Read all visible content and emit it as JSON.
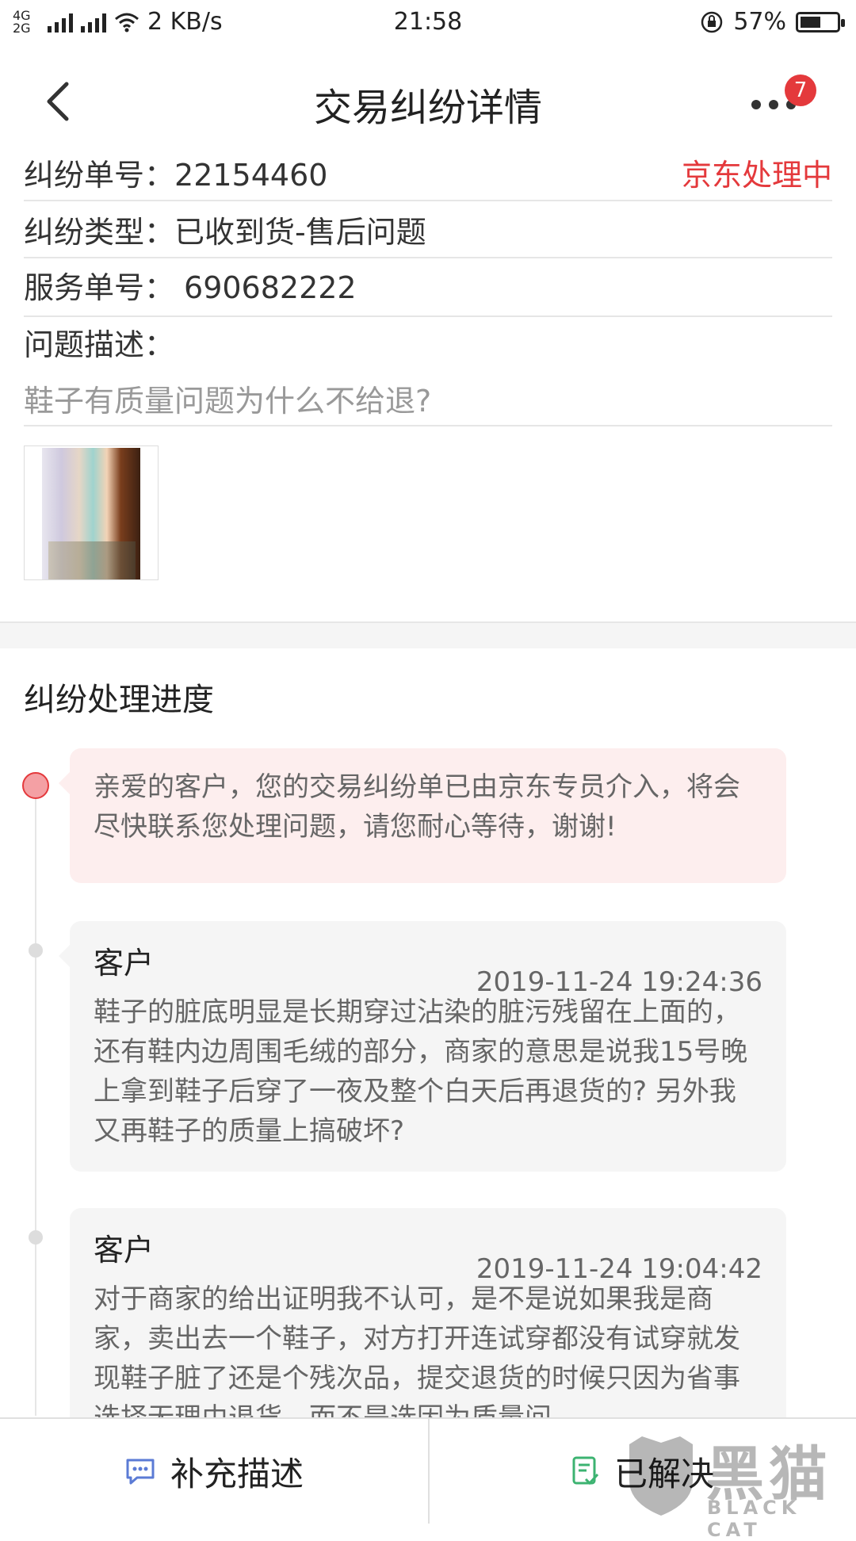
{
  "status_bar": {
    "network": "4G 2G",
    "speed": "2 KB/s",
    "time": "21:58",
    "battery": "57%",
    "battery_level": 0.57
  },
  "header": {
    "title": "交易纠纷详情",
    "badge_count": "7"
  },
  "dispute": {
    "number_label": "纠纷单号：",
    "number_value": "22154460",
    "status": "京东处理中",
    "type_label": "纠纷类型：",
    "type_value": "已收到货-售后问题",
    "service_label": "服务单号：",
    "service_value": "690682222",
    "desc_label": "问题描述：",
    "desc_value": "鞋子有质量问题为什么不给退?"
  },
  "progress": {
    "title": "纠纷处理进度",
    "system_message": "亲爱的客户，您的交易纠纷单已由京东专员介入，将会尽快联系您处理问题，请您耐心等待，谢谢!",
    "entries": [
      {
        "who": "客户",
        "time": "2019-11-24 19:24:36",
        "text": "鞋子的脏底明显是长期穿过沾染的脏污残留在上面的，还有鞋内边周围毛绒的部分，商家的意思是说我15号晚上拿到鞋子后穿了一夜及整个白天后再退货的? 另外我又再鞋子的质量上搞破坏?"
      },
      {
        "who": "客户",
        "time": "2019-11-24 19:04:42",
        "text": "对于商家的给出证明我不认可，是不是说如果我是商家，卖出去一个鞋子，对方打开连试穿都没有试穿就发现鞋子脏了还是个残次品，提交退货的时候只因为省事选择无理由退货，而不是选因为质量问"
      }
    ]
  },
  "bottom": {
    "supplement_label": "补充描述",
    "resolved_label": "已解决"
  },
  "watermark": {
    "cn": "黑猫",
    "en": "BLACK CAT"
  },
  "colors": {
    "accent_red": "#e4393c",
    "pink_bubble": "#fdeeee",
    "icon_blue": "#5b7bd5",
    "icon_green": "#3cb371"
  }
}
